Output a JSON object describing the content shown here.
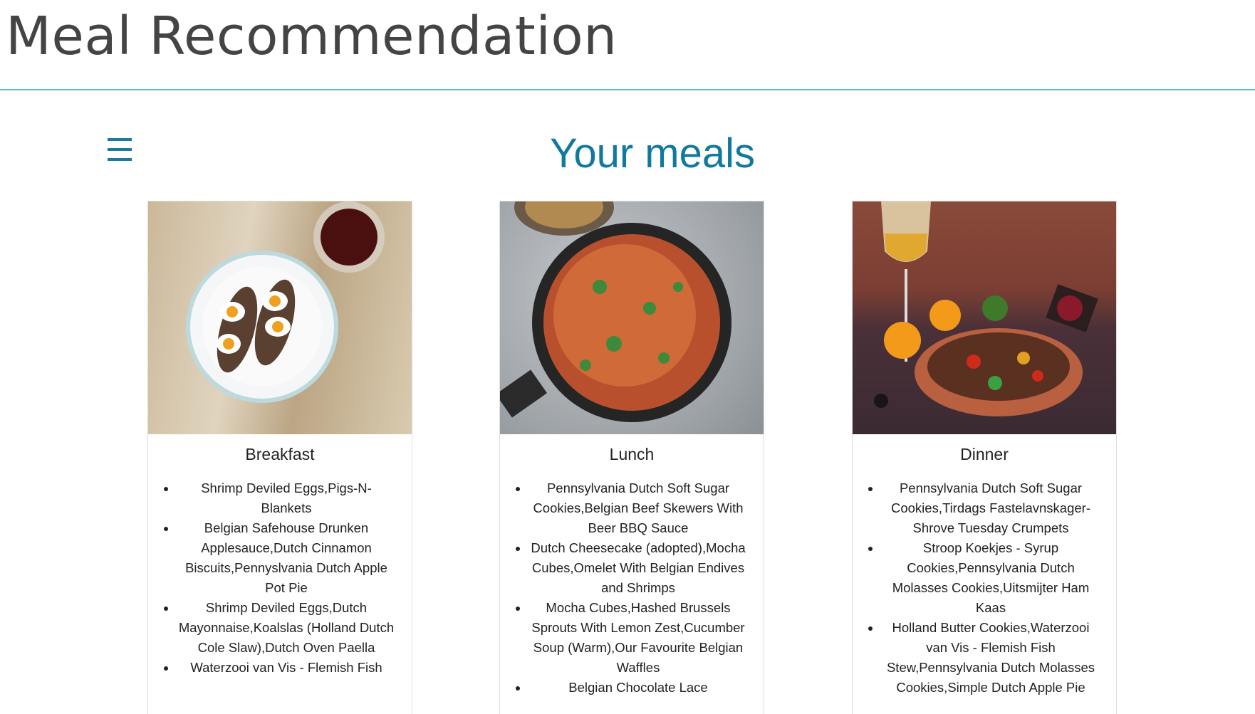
{
  "header": {
    "title": "Meal Recommendation",
    "accent_color": "#5bbfb5"
  },
  "menu": {
    "icon": "hamburger-menu-icon",
    "color": "#1a7aa0"
  },
  "main": {
    "title": "Your meals",
    "title_color": "#1079a0",
    "meals": [
      {
        "label": "Breakfast",
        "image": "eggs-on-toast-photo",
        "items": [
          "Shrimp Deviled Eggs,Pigs-N-Blankets",
          "Belgian Safehouse Drunken Applesauce,Dutch Cinnamon Biscuits,Pennyslvania Dutch Apple Pot Pie",
          "Shrimp Deviled Eggs,Dutch Mayonnaise,Koalslas (Holland Dutch Cole Slaw),Dutch Oven Paella",
          "Waterzooi van Vis - Flemish Fish"
        ]
      },
      {
        "label": "Lunch",
        "image": "stew-in-pan-photo",
        "items": [
          "Pennsylvania Dutch Soft Sugar Cookies,Belgian Beef Skewers With Beer BBQ Sauce",
          "Dutch Cheesecake (adopted),Mocha Cubes,Omelet With Belgian Endives and Shrimps",
          "Mocha Cubes,Hashed Brussels Sprouts With Lemon Zest,Cucumber Soup (Warm),Our Favourite Belgian Waffles",
          "Belgian Chocolate Lace"
        ]
      },
      {
        "label": "Dinner",
        "image": "meat-bowl-with-wine-photo",
        "items": [
          "Pennsylvania Dutch Soft Sugar Cookies,Tirdags Fastelavnskager-Shrove Tuesday Crumpets",
          "Stroop Koekjes - Syrup Cookies,Pennsylvania Dutch Molasses Cookies,Uitsmijter Ham Kaas",
          "Holland Butter Cookies,Waterzooi van Vis - Flemish Fish Stew,Pennsylvania Dutch Molasses Cookies,Simple Dutch Apple Pie"
        ]
      }
    ]
  }
}
